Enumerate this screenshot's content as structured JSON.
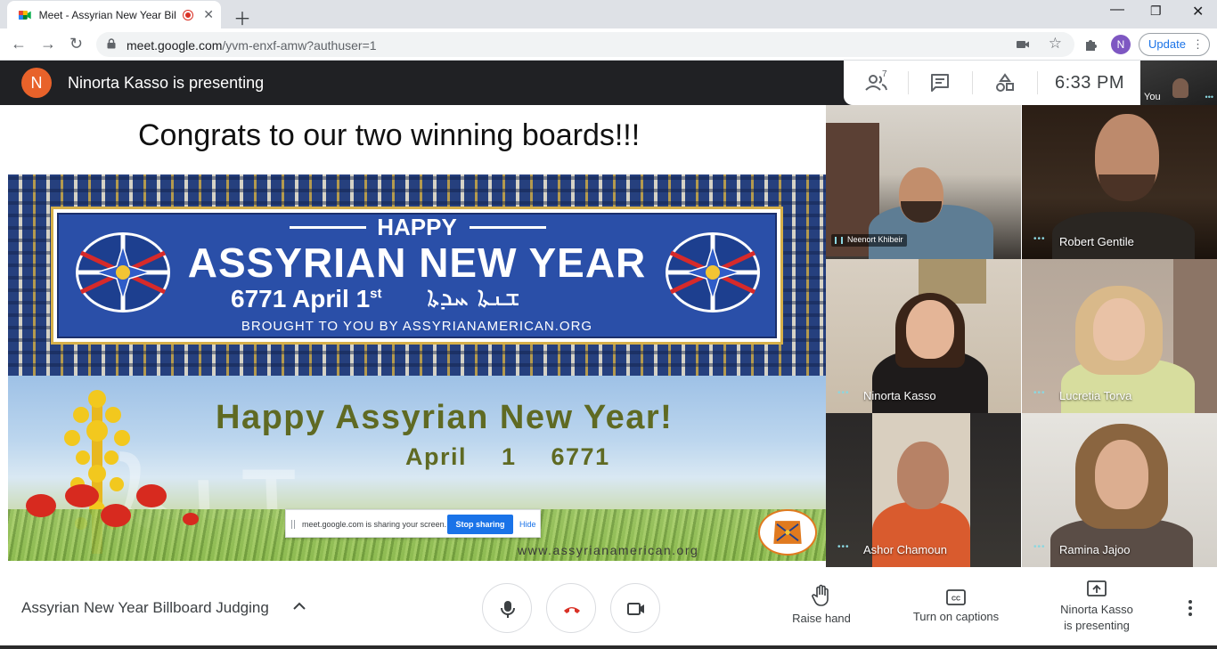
{
  "browser": {
    "tab_title": "Meet - Assyrian New Year Bil",
    "new_tab_icon": "plus-icon",
    "url_host": "meet.google.com",
    "url_path": "/yvm-enxf-amw?authuser=1",
    "profile_initial": "N",
    "update_label": "Update"
  },
  "meet": {
    "presenter_initial": "N",
    "presenting_title": "Ninorta Kasso is presenting",
    "participant_count": "7",
    "time": "6:33 PM",
    "self_label": "You",
    "meeting_title": "Assyrian New Year Billboard Judging",
    "actions": {
      "raise_hand": "Raise hand",
      "captions": "Turn on captions",
      "presenting_line1": "Ninorta Kasso",
      "presenting_line2": "is presenting"
    }
  },
  "slide": {
    "heading": "Congrats to our two winning boards!!!",
    "board1": {
      "happy": "HAPPY",
      "title": "ASSYRIAN NEW YEAR",
      "date_main": "6771 April 1",
      "date_sup": "st",
      "syriac": "ܫܢܬܐ ܚܕܬܐ",
      "brought_by": "BROUGHT TO YOU BY ASSYRIANAMERICAN.ORG"
    },
    "board2": {
      "title": "Happy Assyrian New Year!",
      "date": "April 1 6771",
      "site": "www.assyrianamerican.org"
    }
  },
  "share_notice": {
    "message": "meet.google.com is sharing your screen.",
    "stop_label": "Stop sharing",
    "hide_label": "Hide"
  },
  "participants": [
    {
      "name": "Neenort Khibeir"
    },
    {
      "name": "Robert Gentile"
    },
    {
      "name": "Ninorta Kasso"
    },
    {
      "name": "Lucretia Torva"
    },
    {
      "name": "Ashor Chamoun"
    },
    {
      "name": "Ramina Jajoo"
    }
  ],
  "colors": {
    "meet_dark": "#202124",
    "hangup_red": "#d93025",
    "accent_blue": "#1a73e8",
    "avatar_orange": "#e8622a",
    "board_blue": "#2a4fa8",
    "board_olive": "#5f6a23"
  }
}
